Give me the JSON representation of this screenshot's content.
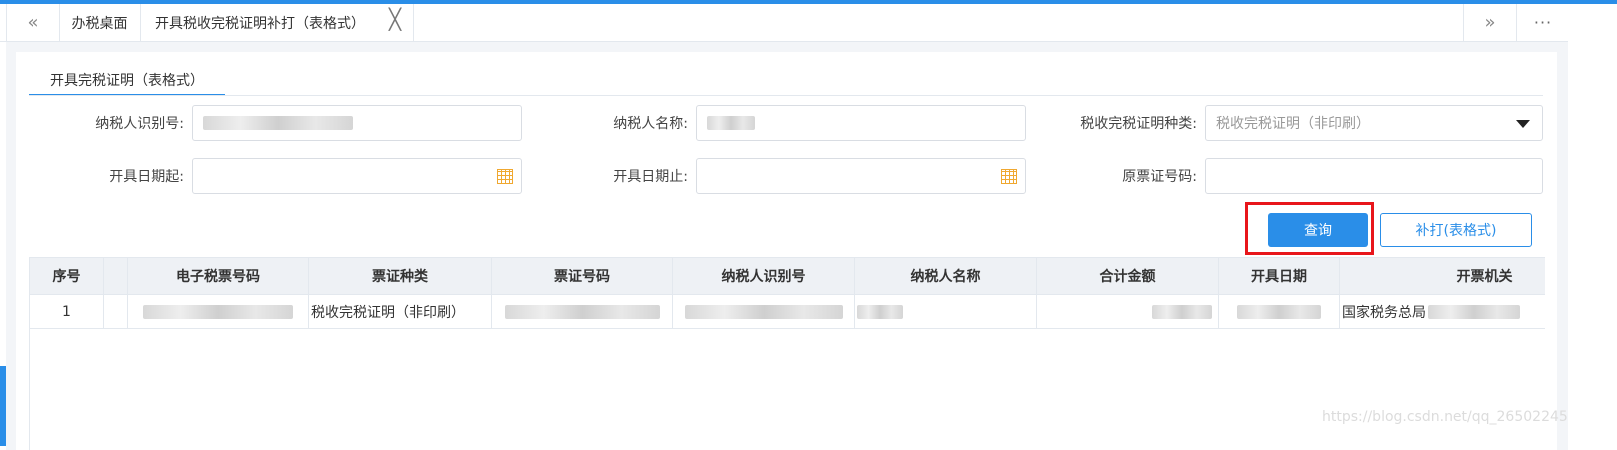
{
  "tabs": {
    "prev_icon": "«",
    "next_icon": "»",
    "more_icon": "···",
    "items": [
      {
        "label": "办税桌面"
      },
      {
        "label": "开具税收完税证明补打（表格式）"
      }
    ],
    "close_icon": "╳"
  },
  "subtab": {
    "label": "开具完税证明（表格式）"
  },
  "form": {
    "taxpayer_id_label": "纳税人识别号:",
    "taxpayer_name_label": "纳税人名称:",
    "cert_type_label": "税收完税证明种类:",
    "cert_type_value": "税收完税证明（非印刷）",
    "date_from_label": "开具日期起:",
    "date_to_label": "开具日期止:",
    "orig_ticket_label": "原票证号码:"
  },
  "buttons": {
    "query": "查询",
    "print": "补打(表格式)"
  },
  "table": {
    "headers": [
      "序号",
      "",
      "电子税票号码",
      "票证种类",
      "票证号码",
      "纳税人识别号",
      "纳税人名称",
      "合计金额",
      "开具日期",
      "开票机关"
    ],
    "rows": [
      {
        "index": "1",
        "ticket_type": "税收完税证明（非印刷）",
        "issuer_prefix": "国家税务总局"
      }
    ]
  },
  "watermark": "https://blog.csdn.net/qq_26502245",
  "colors": {
    "accent": "#2a8ee8",
    "highlight": "#e8161b",
    "icon_orange": "#f0a830"
  }
}
